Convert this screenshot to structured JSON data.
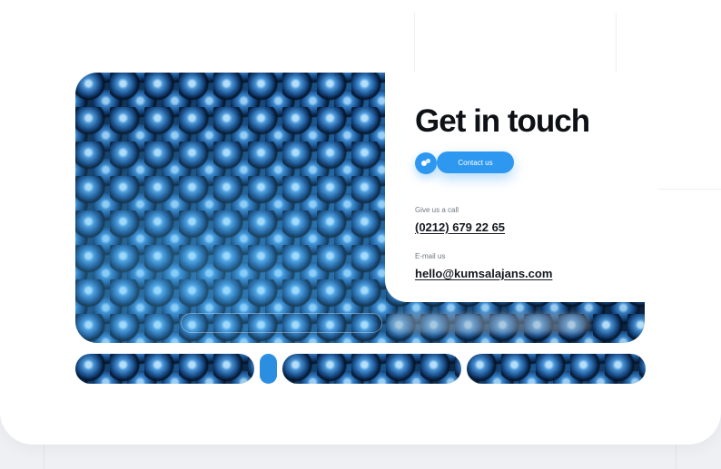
{
  "contact": {
    "title": "Get in touch",
    "contact_button_label": "Contact us",
    "chat_icon": "chat-bubbles-icon",
    "phone_label": "Give us a call",
    "phone_value": "(0212) 679 22 65",
    "email_label": "E-mail us",
    "email_value": "hello@kumsalajans.com"
  },
  "colors": {
    "accent": "#2e98f0",
    "text": "#0e1116",
    "muted": "#707781",
    "page_background": "#eef0f4"
  }
}
